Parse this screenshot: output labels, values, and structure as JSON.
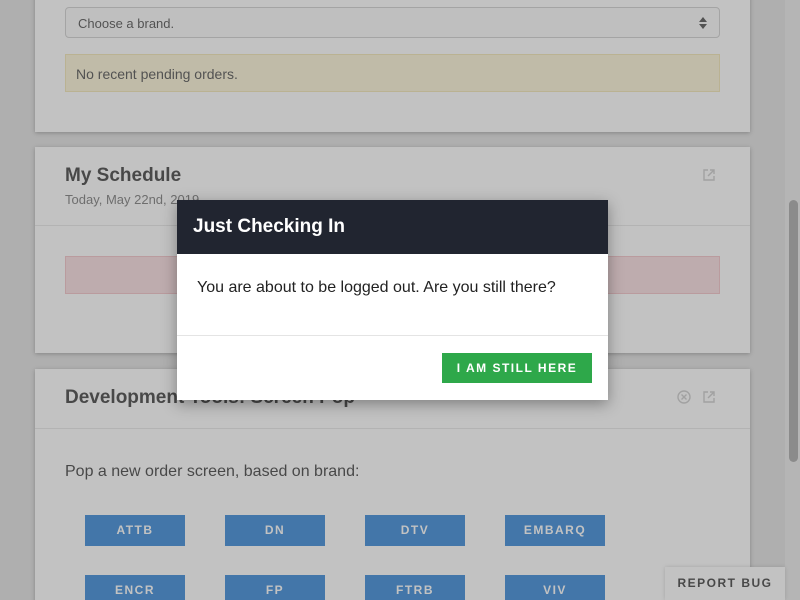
{
  "brand_selector": {
    "placeholder": "Choose a brand."
  },
  "pending_orders": {
    "message": "No recent pending orders."
  },
  "schedule_card": {
    "title": "My Schedule",
    "date": "Today, May 22nd, 2019"
  },
  "dev_tools_card": {
    "title": "Development Tools: Screen Pop",
    "instruction": "Pop a new order screen, based on brand:",
    "brands": [
      "ATTB",
      "DN",
      "DTV",
      "EMBARQ",
      "ENCR",
      "FP",
      "FTRB",
      "VIV"
    ]
  },
  "report_bug": {
    "label": "REPORT BUG"
  },
  "modal": {
    "title": "Just Checking In",
    "message": "You are about to be logged out. Are you still there?",
    "confirm_label": "I AM STILL HERE"
  },
  "colors": {
    "brand_button": "#1976d2",
    "confirm_button": "#2ea84a",
    "modal_header": "#212530",
    "alert_warning": "#fcf3cf",
    "alert_error": "#f8d7da"
  },
  "icons": [
    "external-link-icon",
    "close-circle-icon",
    "select-arrows-icon"
  ]
}
